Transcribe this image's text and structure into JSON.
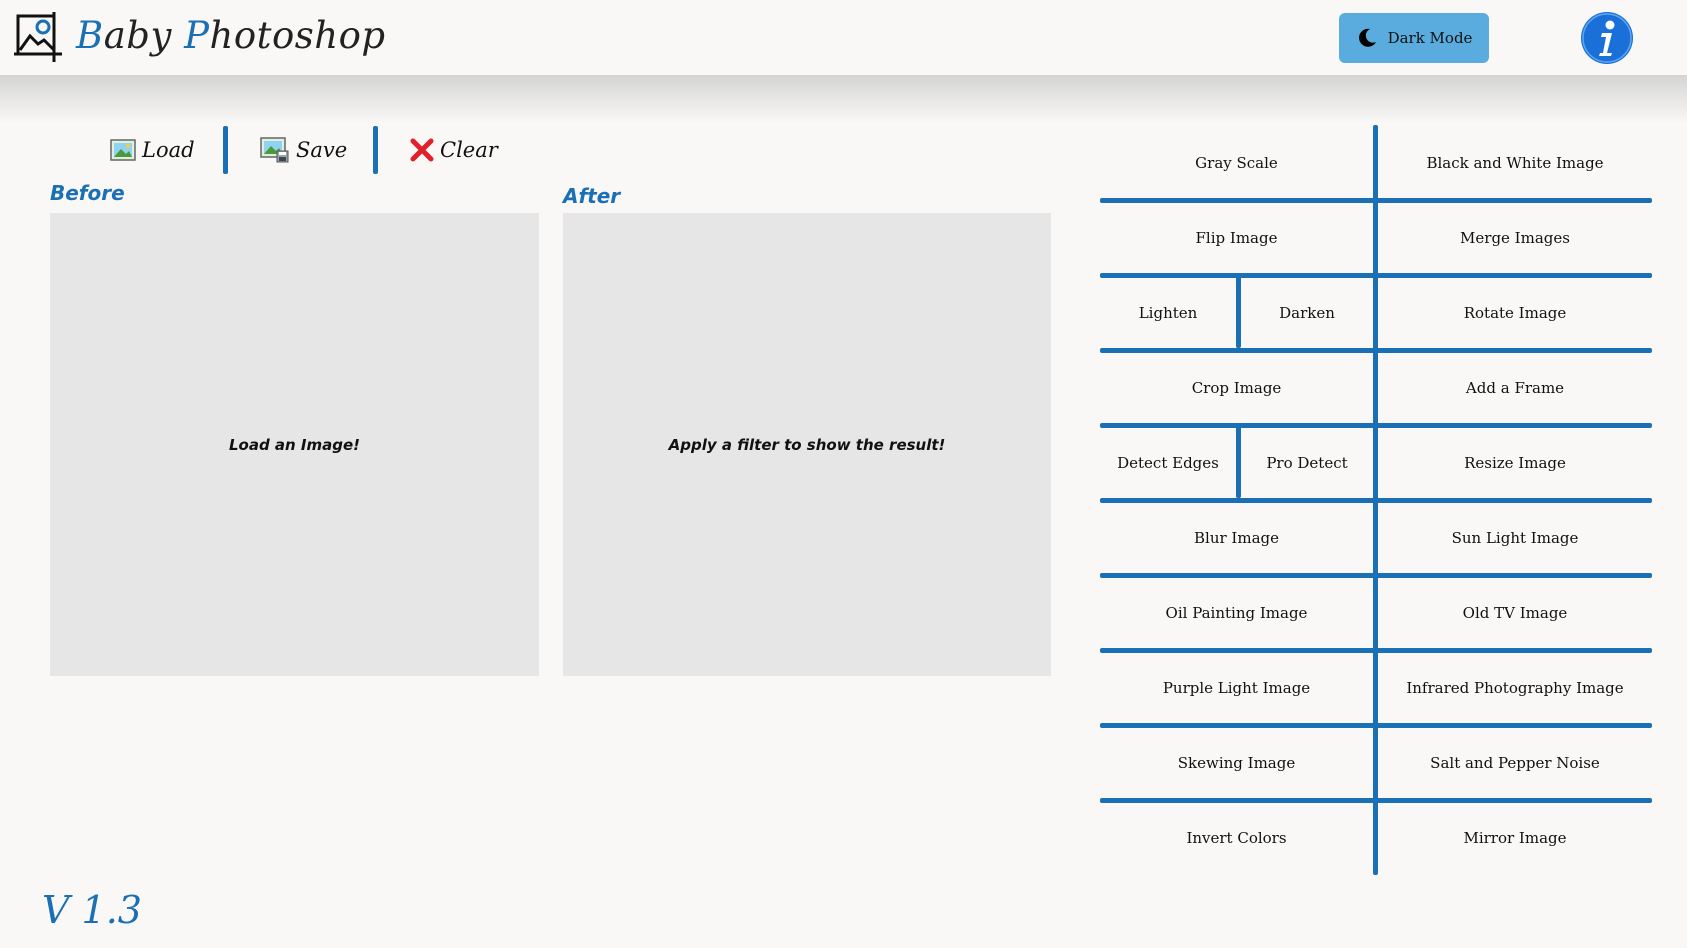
{
  "header": {
    "title_first_letter": "B",
    "title_word1_rest": "aby ",
    "title_second_letter": "P",
    "title_word2_rest": "hotoshop",
    "dark_mode_label": "Dark Mode"
  },
  "toolbar": {
    "load_label": "Load",
    "save_label": "Save",
    "clear_label": "Clear"
  },
  "panels": {
    "before_label": "Before",
    "before_message": "Load an Image!",
    "after_label": "After",
    "after_message": "Apply a filter to show the result!"
  },
  "filters": {
    "gray_scale": "Gray Scale",
    "black_white": "Black and White Image",
    "flip": "Flip Image",
    "merge": "Merge Images",
    "lighten": "Lighten",
    "darken": "Darken",
    "rotate": "Rotate Image",
    "crop": "Crop Image",
    "frame": "Add a Frame",
    "detect_edges": "Detect Edges",
    "pro_detect": "Pro Detect",
    "resize": "Resize Image",
    "blur": "Blur Image",
    "sun_light": "Sun Light Image",
    "oil_painting": "Oil Painting Image",
    "old_tv": "Old TV Image",
    "purple_light": "Purple Light Image",
    "infrared": "Infrared Photography Image",
    "skewing": "Skewing Image",
    "salt_pepper": "Salt and Pepper Noise",
    "invert": "Invert Colors",
    "mirror": "Mirror Image"
  },
  "footer": {
    "version": "V 1.3"
  },
  "colors": {
    "accent": "#1a6fb5",
    "dark_mode_button": "#5aacde",
    "panel_bg": "#e6e6e6",
    "page_bg": "#f9f8f6"
  },
  "icons": {
    "logo": "image-frame-icon",
    "dark_mode": "moon-icon",
    "info": "info-icon",
    "load": "picture-icon",
    "save": "picture-save-icon",
    "clear": "red-x-icon"
  }
}
